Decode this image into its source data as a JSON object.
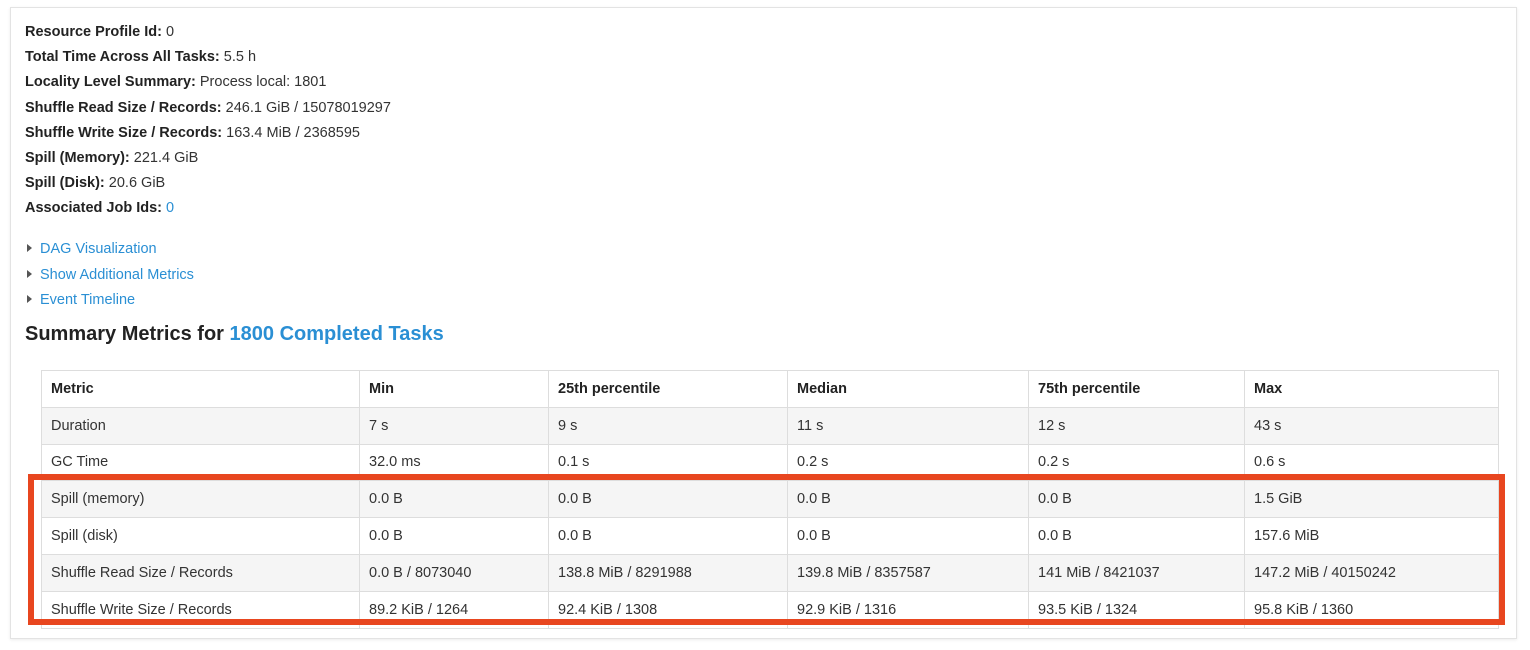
{
  "details": {
    "resource_profile_label": "Resource Profile Id:",
    "resource_profile_value": "0",
    "total_time_label": "Total Time Across All Tasks:",
    "total_time_value": "5.5 h",
    "locality_label": "Locality Level Summary:",
    "locality_value": "Process local: 1801",
    "shuffle_read_label": "Shuffle Read Size / Records:",
    "shuffle_read_value": "246.1 GiB / 15078019297",
    "shuffle_write_label": "Shuffle Write Size / Records:",
    "shuffle_write_value": "163.4 MiB / 2368595",
    "spill_memory_label": "Spill (Memory):",
    "spill_memory_value": "221.4 GiB",
    "spill_disk_label": "Spill (Disk):",
    "spill_disk_value": "20.6 GiB",
    "job_ids_label": "Associated Job Ids:",
    "job_ids_value": "0"
  },
  "toggles": {
    "dag": "DAG Visualization",
    "additional_metrics": "Show Additional Metrics",
    "event_timeline": "Event Timeline"
  },
  "summary": {
    "heading_prefix": "Summary Metrics for",
    "heading_link": "1800 Completed Tasks"
  },
  "table": {
    "headers": [
      "Metric",
      "Min",
      "25th percentile",
      "Median",
      "75th percentile",
      "Max"
    ],
    "rows": [
      [
        "Duration",
        "7 s",
        "9 s",
        "11 s",
        "12 s",
        "43 s"
      ],
      [
        "GC Time",
        "32.0 ms",
        "0.1 s",
        "0.2 s",
        "0.2 s",
        "0.6 s"
      ],
      [
        "Spill (memory)",
        "0.0 B",
        "0.0 B",
        "0.0 B",
        "0.0 B",
        "1.5 GiB"
      ],
      [
        "Spill (disk)",
        "0.0 B",
        "0.0 B",
        "0.0 B",
        "0.0 B",
        "157.6 MiB"
      ],
      [
        "Shuffle Read Size / Records",
        "0.0 B / 8073040",
        "138.8 MiB / 8291988",
        "139.8 MiB / 8357587",
        "141 MiB / 8421037",
        "147.2 MiB / 40150242"
      ],
      [
        "Shuffle Write Size / Records",
        "89.2 KiB / 1264",
        "92.4 KiB / 1308",
        "92.9 KiB / 1316",
        "93.5 KiB / 1324",
        "95.8 KiB / 1360"
      ]
    ]
  },
  "colors": {
    "link": "#2a8fd4",
    "highlight_border": "#e8461f",
    "row_stripe": "#f5f5f5"
  }
}
